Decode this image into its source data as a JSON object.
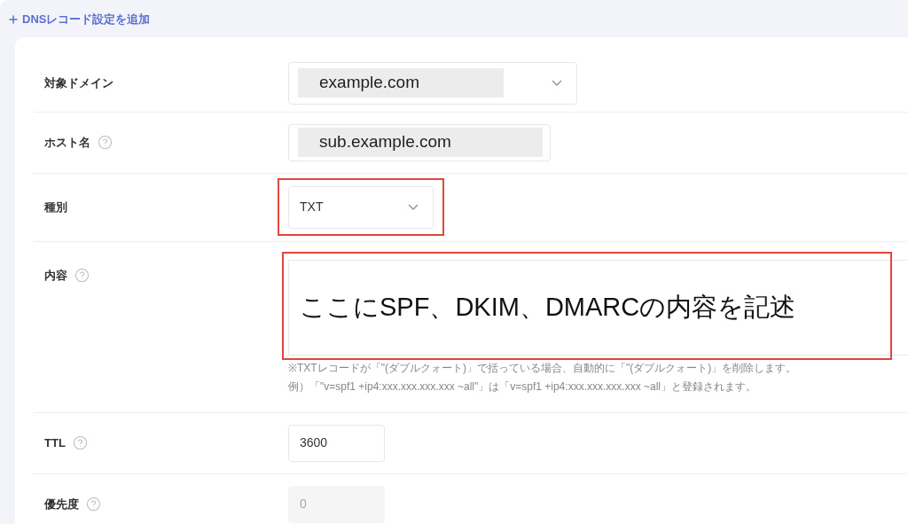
{
  "header": {
    "link": "DNSレコード設定を追加"
  },
  "rows": [
    {
      "label": "対象ドメイン",
      "help": false,
      "kind": "select",
      "value": "example.com",
      "masked": true
    },
    {
      "label": "ホスト名",
      "help": true,
      "kind": "text",
      "value": "sub.example.com",
      "masked": true
    },
    {
      "label": "種別",
      "help": false,
      "kind": "select",
      "value": "TXT",
      "highlighted": true
    },
    {
      "label": "内容",
      "help": true,
      "kind": "textarea",
      "value": "ここにSPF、DKIM、DMARCの内容を記述",
      "highlighted": true,
      "notes": [
        "※TXTレコードが「\"(ダブルクォート)」で括っている場合、自動的に「\"(ダブルクォート)」を削除します。",
        "例）「\"v=spf1 +ip4:xxx.xxx.xxx.xxx ~all\"」は「v=spf1 +ip4:xxx.xxx.xxx.xxx ~all」と登録されます。"
      ]
    },
    {
      "label": "TTL",
      "help": true,
      "kind": "text",
      "value": "3600"
    },
    {
      "label": "優先度",
      "help": true,
      "kind": "text",
      "placeholder": "0",
      "disabled": true
    }
  ]
}
